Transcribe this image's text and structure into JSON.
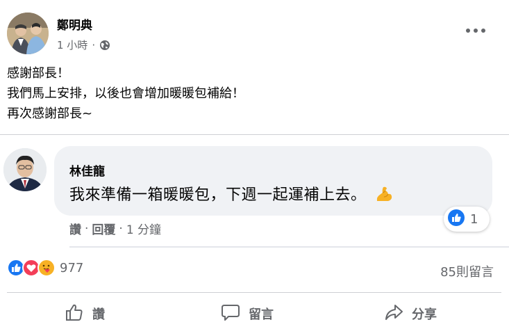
{
  "post": {
    "author": "鄭明典",
    "time": "1 小時",
    "dot": "·",
    "privacy_icon": "globe-icon",
    "more_icon": "more-options-icon",
    "text_lines": [
      "感謝部長！",
      "我們馬上安排，以後也會增加暖暖包補給！",
      "再次感謝部長~"
    ]
  },
  "comment": {
    "author": "林佳龍",
    "text": "我來準備一箱暖暖包，下週一起運補上去。",
    "emoji": "flexed-biceps-emoji",
    "reaction_count": "1",
    "actions": {
      "like": "讚",
      "sep1": "·",
      "reply": "回覆",
      "sep2": "·",
      "time": "1 分鐘"
    }
  },
  "summary": {
    "reaction_count": "977",
    "comments_label": "85則留言",
    "reaction_icons": [
      "like-reaction-icon",
      "love-reaction-icon",
      "care-reaction-icon"
    ]
  },
  "action_bar": {
    "like": "讚",
    "comment": "留言",
    "share": "分享"
  },
  "colors": {
    "facebook_blue": "#1877f2",
    "secondary_text": "#65676b",
    "bubble_bg": "#f0f2f5",
    "love_red": "#f33e58",
    "care_yellow": "#f7b125"
  }
}
